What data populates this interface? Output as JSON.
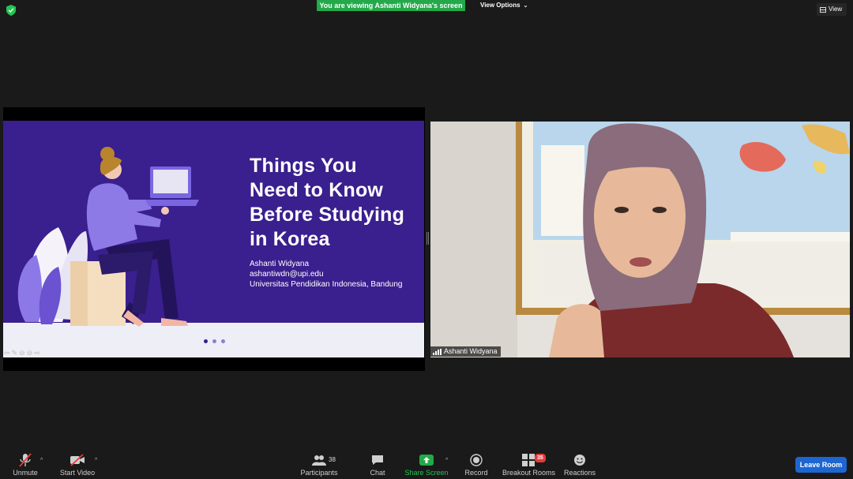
{
  "top": {
    "banner": "You are viewing Ashanti Widyana's screen",
    "view_options": "View Options",
    "view_button": "View"
  },
  "slide": {
    "title_lines": [
      "Things You",
      "Need to Know",
      "Before Studying",
      "in Korea"
    ],
    "author": "Ashanti Widyana",
    "email": "ashantiwdn@upi.edu",
    "institution": "Universitas Pendidikan Indonesia, Bandung"
  },
  "video": {
    "participant_name": "Ashanti Widyana"
  },
  "toolbar": {
    "unmute": "Unmute",
    "start_video": "Start Video",
    "participants": "Participants",
    "participants_count": "38",
    "chat": "Chat",
    "share_screen": "Share Screen",
    "record": "Record",
    "breakout_rooms": "Breakout Rooms",
    "breakout_badge": "35",
    "reactions": "Reactions",
    "leave_room": "Leave Room"
  },
  "colors": {
    "share_green": "#23a94a",
    "slide_purple": "#3a1f8e",
    "leave_blue": "#1d66d2"
  }
}
